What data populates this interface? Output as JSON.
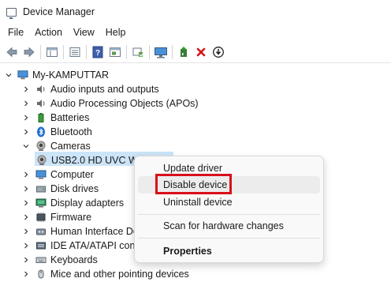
{
  "window": {
    "title": "Device Manager"
  },
  "menubar": {
    "items": [
      "File",
      "Action",
      "View",
      "Help"
    ]
  },
  "toolbar": {
    "icons": [
      "back-icon",
      "forward-icon",
      "properties-icon",
      "view-icon",
      "help-icon",
      "console-icon",
      "scan-icon",
      "monitor-icon",
      "update-driver-icon",
      "uninstall-icon",
      "disable-icon"
    ]
  },
  "tree": {
    "root": "My-KAMPUTTAR",
    "categories": [
      "Audio inputs and outputs",
      "Audio Processing Objects (APOs)",
      "Batteries",
      "Bluetooth",
      "Cameras",
      "Computer",
      "Disk drives",
      "Display adapters",
      "Firmware",
      "Human Interface Dev",
      "IDE ATA/ATAPI contr",
      "Keyboards",
      "Mice and other pointing devices"
    ],
    "selected_device": "USB2.0 HD UVC WebCam"
  },
  "context_menu": {
    "items": [
      "Update driver",
      "Disable device",
      "Uninstall device",
      "Scan for hardware changes",
      "Properties"
    ],
    "highlighted": "Disable device",
    "accent": "#d9101a"
  }
}
